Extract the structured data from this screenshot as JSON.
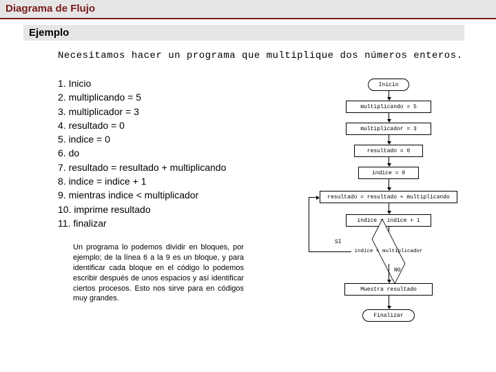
{
  "title": "Diagrama de Flujo",
  "subtitle": "Ejemplo",
  "problem": "Necesitamos hacer un programa que multiplique dos números enteros.",
  "steps": {
    "s1": "1. Inicio",
    "s2": "2. multiplicando = 5",
    "s3": "3. multiplicador = 3",
    "s4": "4. resultado = 0",
    "s5": "5. indice = 0",
    "s6": "6. do",
    "s7": "7. resultado = resultado + multiplicando",
    "s8": "8. indice = indice + 1",
    "s9": "9. mientras indice < multiplicador",
    "s10": "10. imprime resultado",
    "s11": "11. finalizar"
  },
  "note": "Un programa lo podemos dividir en bloques, por ejemplo; de la línea 6 a la 9 es un bloque, y para identificar cada bloque en el código lo podemos escribir después de unos espacios y así identificar ciertos procesos. Esto nos sirve para en códigos muy grandes.",
  "flow": {
    "inicio": "Inicio",
    "p1": "multiplicando = 5",
    "p2": "multiplicador = 3",
    "p3": "resultado = 0",
    "p4": "indice = 0",
    "p5": "resultado = resultado + multiplicando",
    "p6": "indice = indice + 1",
    "cond": "indice < multiplicador",
    "si": "SI",
    "no": "NO",
    "out": "Muestra resultado",
    "fin": "Finalizar"
  }
}
